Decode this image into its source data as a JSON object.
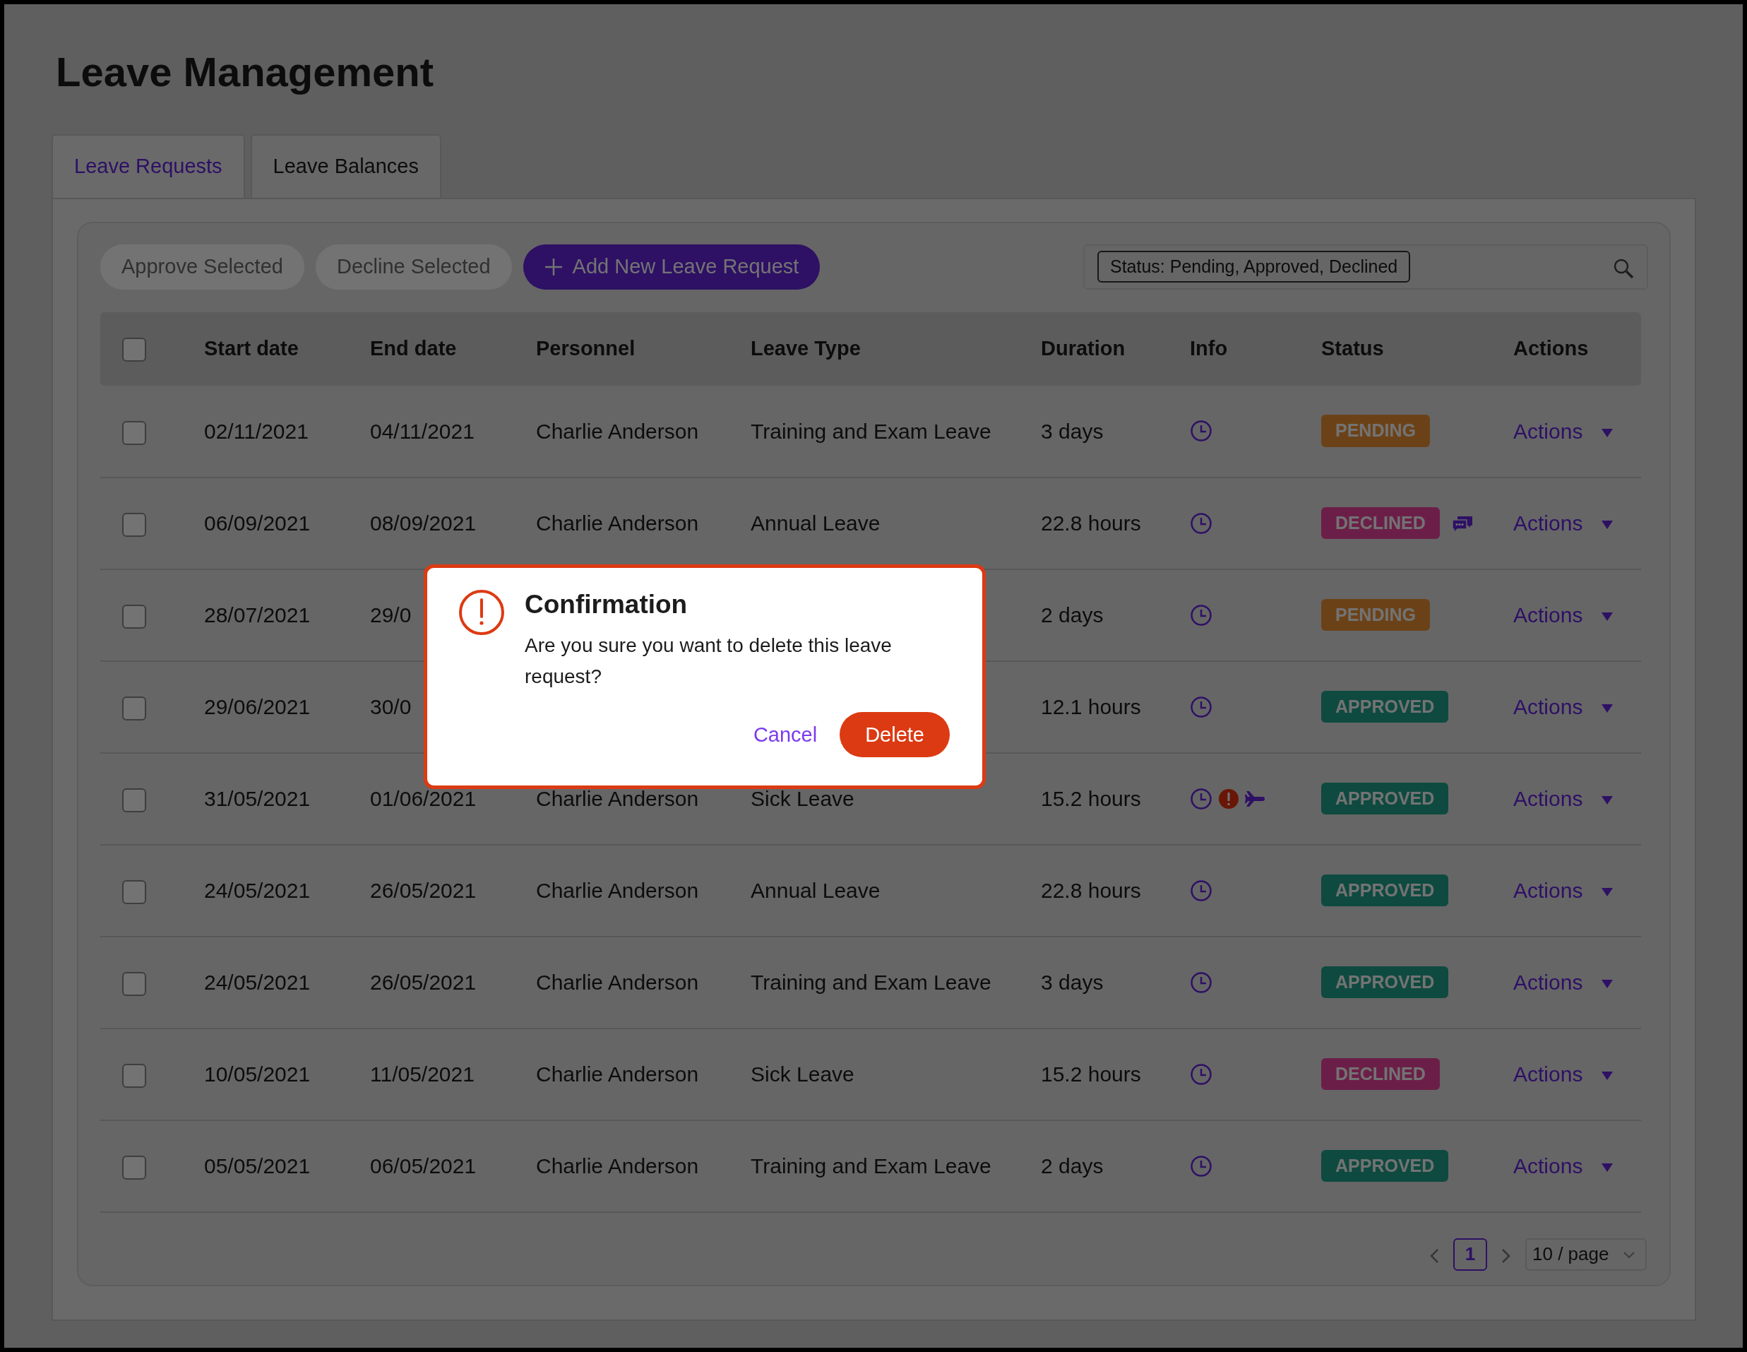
{
  "page_title": "Leave Management",
  "tabs": [
    {
      "label": "Leave Requests",
      "selected": true
    },
    {
      "label": "Leave Balances",
      "selected": false
    }
  ],
  "toolbar": {
    "buttons": [
      {
        "label": "Approve Selected",
        "kind": "muted"
      },
      {
        "label": "Decline Selected",
        "kind": "muted"
      },
      {
        "label": "Add New Leave Request",
        "kind": "primary"
      }
    ],
    "filter_tag": "Status: Pending, Approved, Declined"
  },
  "table": {
    "select_all_checked": false,
    "columns": [
      "Start date",
      "End date",
      "Personnel",
      "Leave Type",
      "Duration",
      "Info",
      "Status",
      "Actions"
    ],
    "rows": [
      {
        "start": "02/11/2021",
        "end": "04/11/2021",
        "personnel": "Charlie Anderson",
        "leave_type": "Training and Exam Leave",
        "duration": "3 days",
        "info_icons": [
          {
            "kind": "clock"
          }
        ],
        "status": "PENDING",
        "color": "#6b4218",
        "comment": false,
        "action": "Actions",
        "checked": false
      },
      {
        "start": "06/09/2021",
        "end": "08/09/2021",
        "personnel": "Charlie Anderson",
        "leave_type": "Annual Leave",
        "duration": "22.8 hours",
        "info_icons": [
          {
            "kind": "clock"
          }
        ],
        "status": "DECLINED",
        "color": "#6b1f48",
        "comment": true,
        "action": "Actions",
        "checked": false
      },
      {
        "start": "28/07/2021",
        "end": "29/0",
        "duration": "2 days",
        "info_icons": [
          {
            "kind": "clock"
          }
        ],
        "status": "PENDING",
        "color": "#6b4218",
        "comment": false,
        "action": "Actions",
        "checked": false
      },
      {
        "start": "29/06/2021",
        "end": "30/0",
        "duration": "12.1 hours",
        "info_icons": [
          {
            "kind": "clock"
          }
        ],
        "status": "APPROVED",
        "color": "#0f4a40",
        "comment": false,
        "action": "Actions",
        "checked": false
      },
      {
        "start": "31/05/2021",
        "end": "01/06/2021",
        "personnel": "Charlie Anderson",
        "leave_type": "Sick Leave",
        "duration": "15.2 hours",
        "info_icons": [
          {
            "kind": "clock"
          },
          {
            "kind": "alert"
          },
          {
            "kind": "plane"
          }
        ],
        "status": "APPROVED",
        "color": "#0f4a40",
        "comment": false,
        "action": "Actions",
        "checked": false
      },
      {
        "start": "24/05/2021",
        "end": "26/05/2021",
        "personnel": "Charlie Anderson",
        "leave_type": "Annual Leave",
        "duration": "22.8 hours",
        "info_icons": [
          {
            "kind": "clock"
          }
        ],
        "status": "APPROVED",
        "color": "#0f4a40",
        "comment": false,
        "action": "Actions",
        "checked": false
      },
      {
        "start": "24/05/2021",
        "end": "26/05/2021",
        "personnel": "Charlie Anderson",
        "leave_type": "Training and Exam Leave",
        "duration": "3 days",
        "info_icons": [
          {
            "kind": "clock"
          }
        ],
        "status": "APPROVED",
        "color": "#0f4a40",
        "comment": false,
        "action": "Actions",
        "checked": false
      },
      {
        "start": "10/05/2021",
        "end": "11/05/2021",
        "personnel": "Charlie Anderson",
        "leave_type": "Sick Leave",
        "duration": "15.2 hours",
        "info_icons": [
          {
            "kind": "clock"
          }
        ],
        "status": "DECLINED",
        "color": "#6b1f48",
        "comment": false,
        "action": "Actions",
        "checked": false
      },
      {
        "start": "05/05/2021",
        "end": "06/05/2021",
        "personnel": "Charlie Anderson",
        "leave_type": "Training and Exam Leave",
        "duration": "2 days",
        "info_icons": [
          {
            "kind": "clock"
          }
        ],
        "status": "APPROVED",
        "color": "#0f4a40",
        "comment": false,
        "action": "Actions",
        "checked": false
      }
    ]
  },
  "pagination": {
    "pages": [
      {
        "label": "1",
        "selected": true
      }
    ],
    "page_size": "10 / page"
  },
  "dialog": {
    "title": "Confirmation",
    "message": "Are you sure you want to delete this leave request?",
    "cancel": "Cancel",
    "confirm": "Delete"
  }
}
